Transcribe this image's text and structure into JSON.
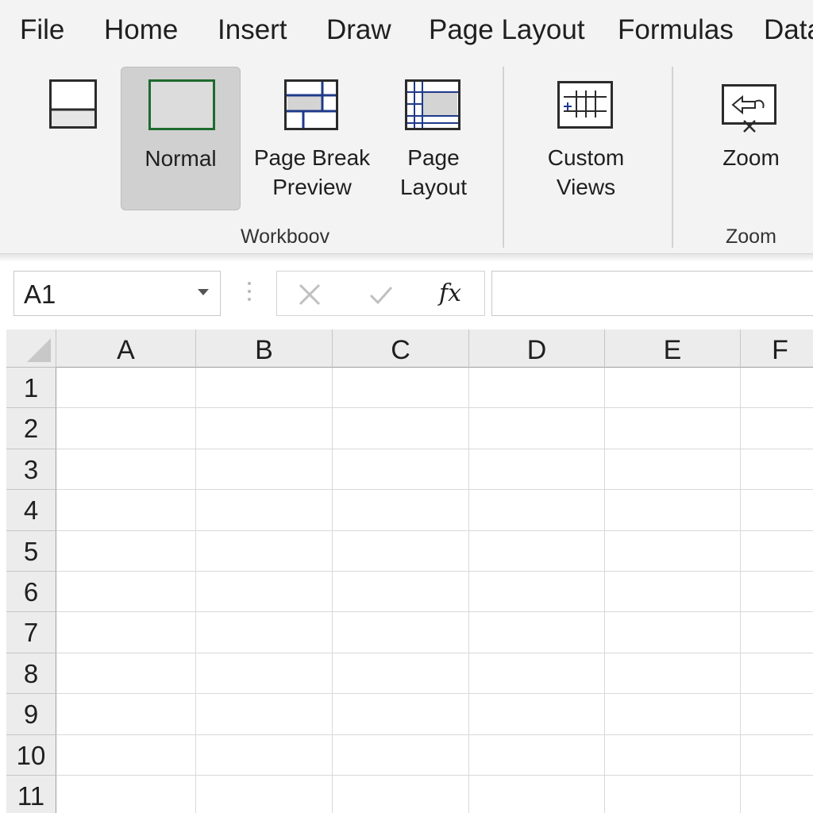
{
  "menu": {
    "items": [
      "File",
      "Home",
      "Insert",
      "Draw",
      "Page Layout",
      "Formulas",
      "Data"
    ]
  },
  "ribbon": {
    "workbook_views": {
      "group_label": "Workboov",
      "buttons": [
        {
          "label_lines": []
        },
        {
          "label_lines": [
            "Normal"
          ],
          "selected": true
        },
        {
          "label_lines": [
            "Page Break",
            "Preview"
          ]
        },
        {
          "label_lines": [
            "Page",
            "Layout"
          ]
        }
      ]
    },
    "custom_views": {
      "label_lines": [
        "Custom",
        "Views"
      ]
    },
    "zoom": {
      "button_label": "Zoom",
      "group_label": "Zoom"
    }
  },
  "formula_bar": {
    "name_box_value": "A1",
    "fx_label": "fx",
    "formula_value": ""
  },
  "sheet": {
    "columns": [
      "A",
      "B",
      "C",
      "D",
      "E",
      "F"
    ],
    "rows": [
      "1",
      "2",
      "3",
      "4",
      "5",
      "6",
      "7",
      "8",
      "9",
      "10",
      "11"
    ]
  },
  "colors": {
    "ribbon_bg": "#f3f3f3",
    "selected_button_bg": "#d0d0d0",
    "icon_blue": "#1f3a8a",
    "header_bg": "#ececec",
    "gridline": "#d9d9d9"
  },
  "icons": [
    "page-view-icon",
    "normal-view-icon",
    "page-break-preview-icon",
    "page-layout-icon",
    "custom-views-icon",
    "zoom-icon",
    "cancel-x-icon",
    "enter-check-icon",
    "select-all-triangle"
  ]
}
